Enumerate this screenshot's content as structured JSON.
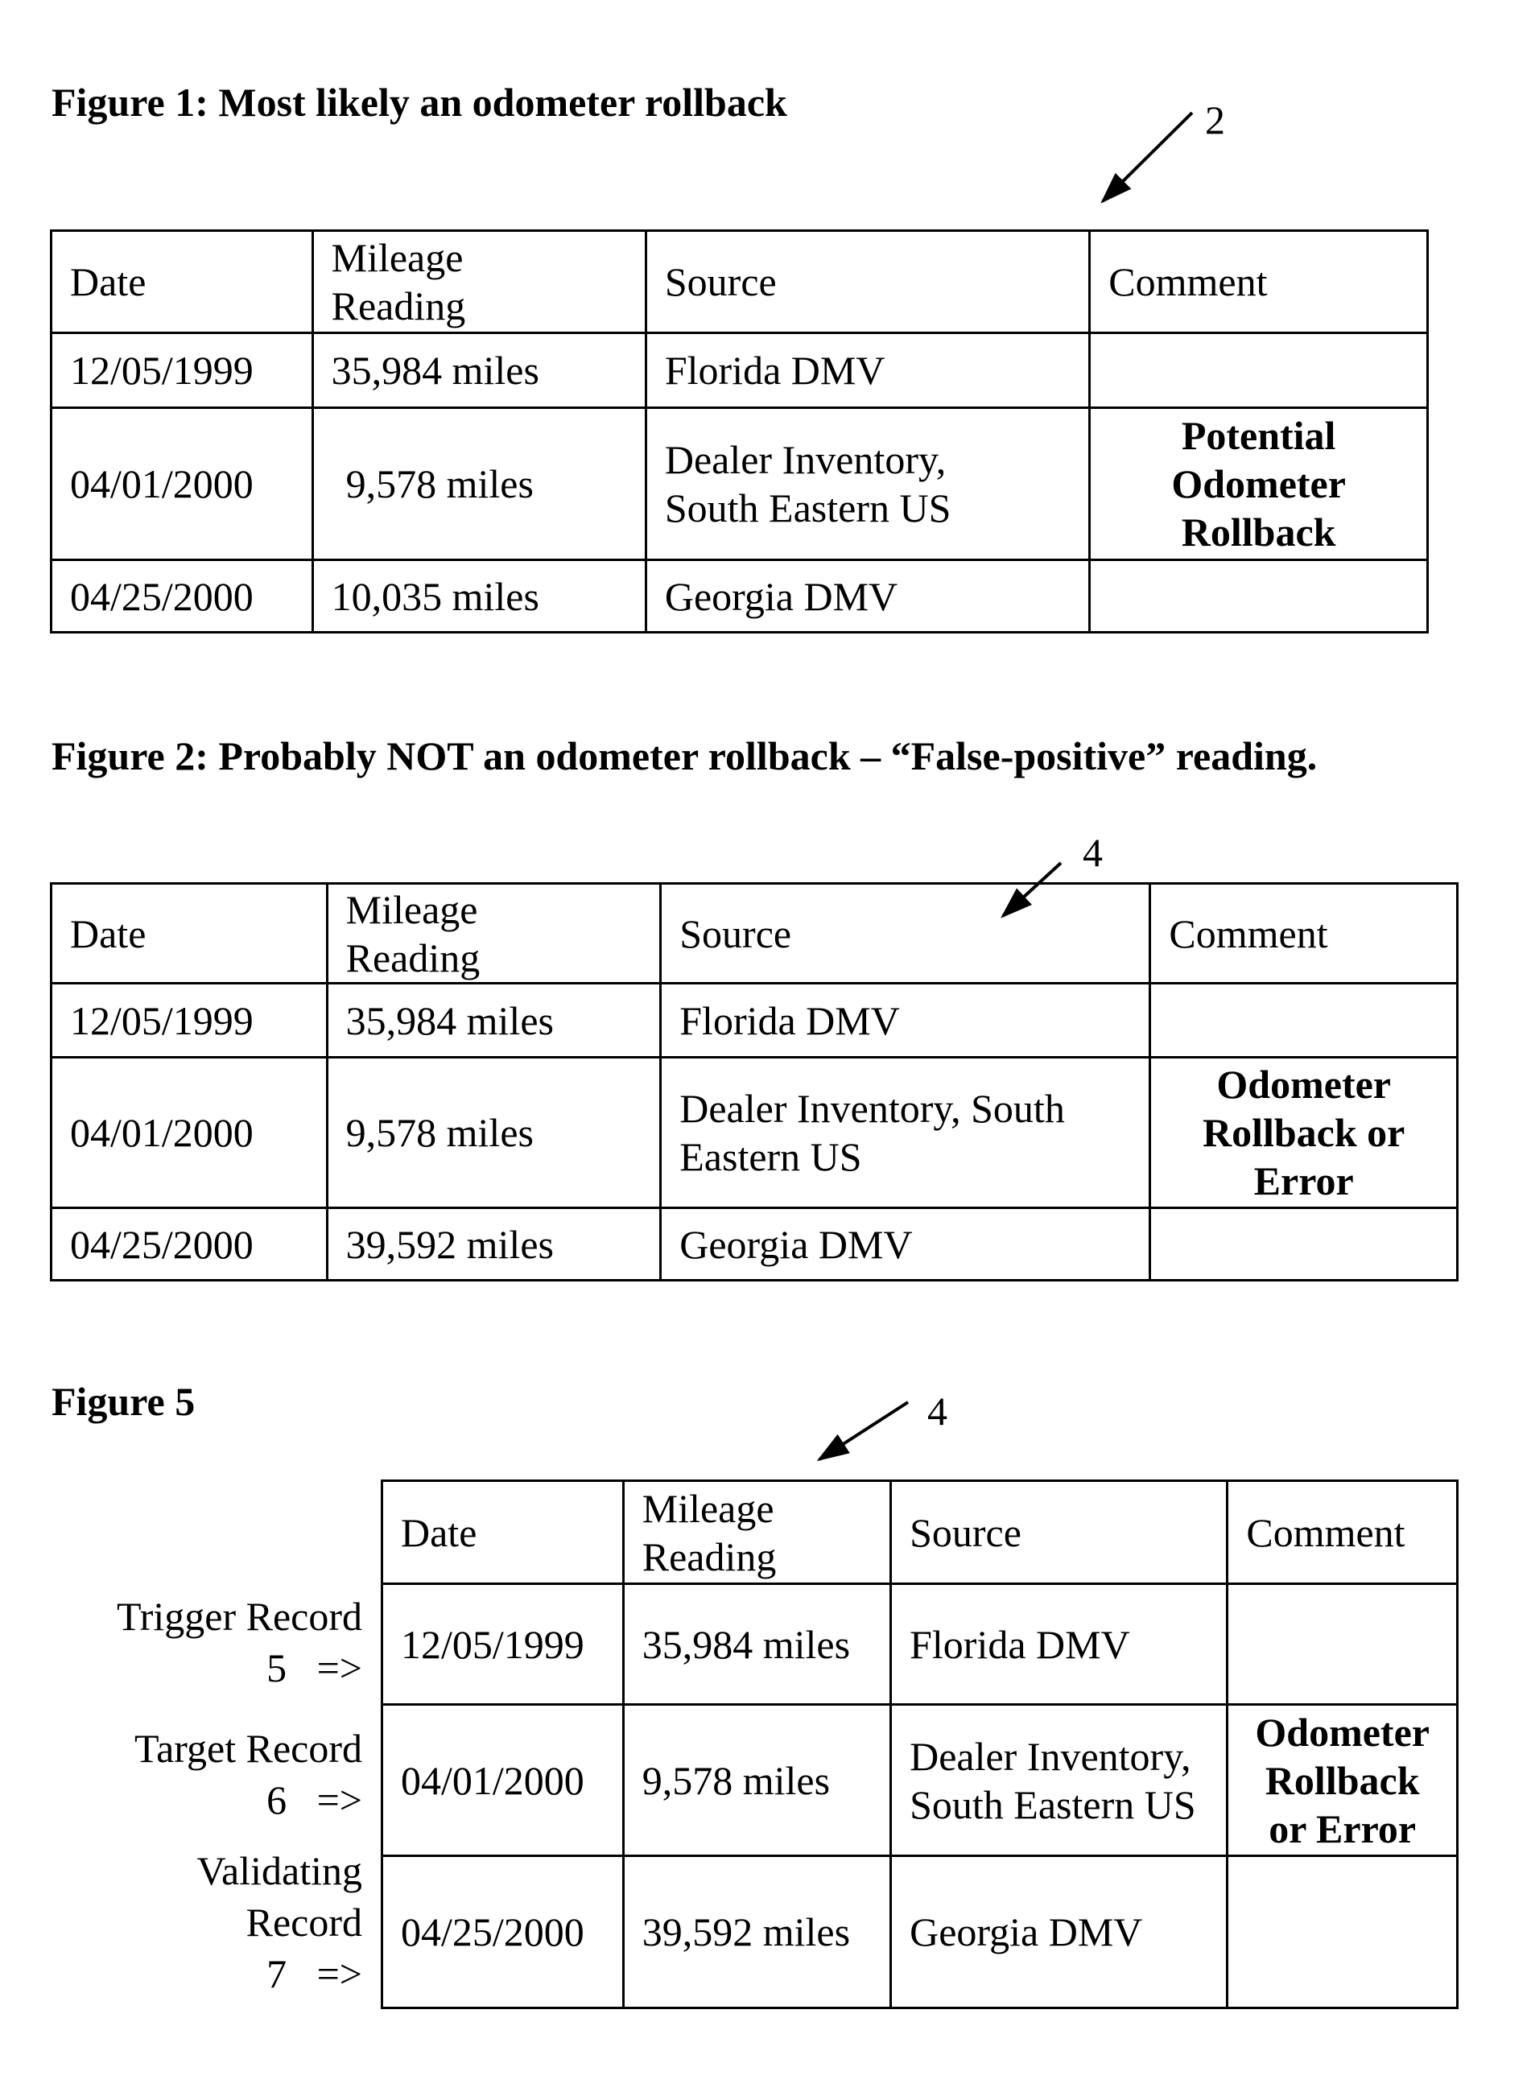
{
  "figures": [
    {
      "title": "Figure 1:  Most likely an odometer rollback",
      "ref_number": "2",
      "headers": [
        "Date",
        "Mileage Reading",
        "Source",
        "Comment"
      ],
      "rows": [
        {
          "date": "12/05/1999",
          "mileage": "35,984 miles",
          "source": "Florida DMV",
          "comment": ""
        },
        {
          "date": "04/01/2000",
          "mileage": "9,578 miles",
          "source": "Dealer Inventory, South Eastern US",
          "comment": "Potential Odometer Rollback"
        },
        {
          "date": "04/25/2000",
          "mileage": "10,035 miles",
          "source": "Georgia DMV",
          "comment": ""
        }
      ]
    },
    {
      "title": "Figure 2:  Probably NOT an odometer rollback – “False-positive” reading.",
      "ref_number": "4",
      "headers": [
        "Date",
        "Mileage Reading",
        "Source",
        "Comment"
      ],
      "rows": [
        {
          "date": "12/05/1999",
          "mileage": "35,984 miles",
          "source": "Florida DMV",
          "comment": ""
        },
        {
          "date": "04/01/2000",
          "mileage": "9,578 miles",
          "source": "Dealer Inventory, South Eastern US",
          "comment": "Odometer Rollback or Error"
        },
        {
          "date": "04/25/2000",
          "mileage": "39,592 miles",
          "source": "Georgia DMV",
          "comment": ""
        }
      ]
    },
    {
      "title": "Figure 5",
      "ref_number": "4",
      "headers": [
        "Date",
        "Mileage Reading",
        "Source",
        "Comment"
      ],
      "row_labels": [
        {
          "name": "Trigger Record",
          "number": "5",
          "arrow": "=>"
        },
        {
          "name": "Target Record",
          "number": "6",
          "arrow": "=>"
        },
        {
          "name": "Validating Record",
          "number": "7",
          "arrow": "=>"
        }
      ],
      "rows": [
        {
          "date": "12/05/1999",
          "mileage": "35,984 miles",
          "source": "Florida DMV",
          "comment": ""
        },
        {
          "date": "04/01/2000",
          "mileage": "9,578 miles",
          "source": "Dealer Inventory, South Eastern US",
          "comment": "Odometer Rollback or Error"
        },
        {
          "date": "04/25/2000",
          "mileage": "39,592 miles",
          "source": "Georgia DMV",
          "comment": ""
        }
      ]
    }
  ]
}
